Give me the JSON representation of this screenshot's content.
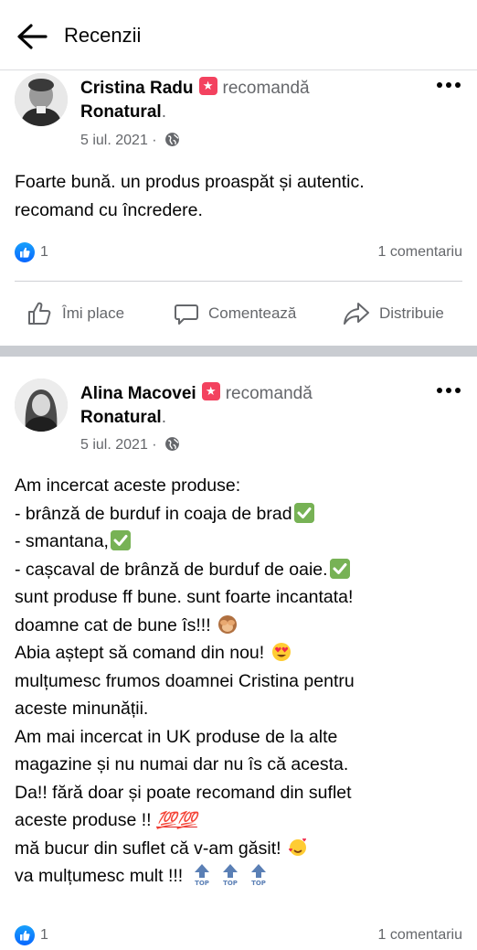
{
  "header": {
    "title": "Recenzii",
    "back_icon": "arrow-left-icon"
  },
  "posts": [
    {
      "author": "Cristina Radu",
      "recommends": "recomandă",
      "page": "Ronatural",
      "date": "5 iul. 2021",
      "privacy_icon": "globe-icon",
      "text": [
        "Foarte bună. un produs proaspăt și autentic.",
        "recomand cu încredere."
      ],
      "likes": "1",
      "comments": "1 comentariu"
    },
    {
      "author": "Alina Macovei",
      "recommends": "recomandă",
      "page": "Ronatural",
      "date": "5 iul. 2021",
      "privacy_icon": "globe-icon",
      "text": [
        "Am incercat aceste produse:",
        "- brânză de burduf in coaja de brad",
        "- smantana,",
        "- cașcaval de brânză de burduf de oaie.",
        "sunt produse ff bune. sunt foarte incantata!",
        "doamne cat de bune îs!!!",
        "Abia aștept să comand din nou!",
        "mulțumesc frumos doamnei Cristina pentru",
        "aceste minunății.",
        "Am mai incercat in UK produse de la alte",
        "magazine și nu numai dar nu îs că acesta.",
        "Da!! fără doar și poate recomand din suflet",
        "aceste produse !!",
        "mă bucur din suflet că v-am găsit!",
        "va mulțumesc mult !!!"
      ],
      "likes": "1",
      "comments": "1 comentariu"
    }
  ],
  "actions": {
    "like": "Îmi place",
    "comment": "Comentează",
    "share": "Distribuie"
  },
  "emoji": {
    "hundred": "💯💯",
    "top": "TOP"
  },
  "colors": {
    "like_blue": "#0866ff",
    "badge_red": "#f3425f",
    "check_green": "#77b255"
  }
}
